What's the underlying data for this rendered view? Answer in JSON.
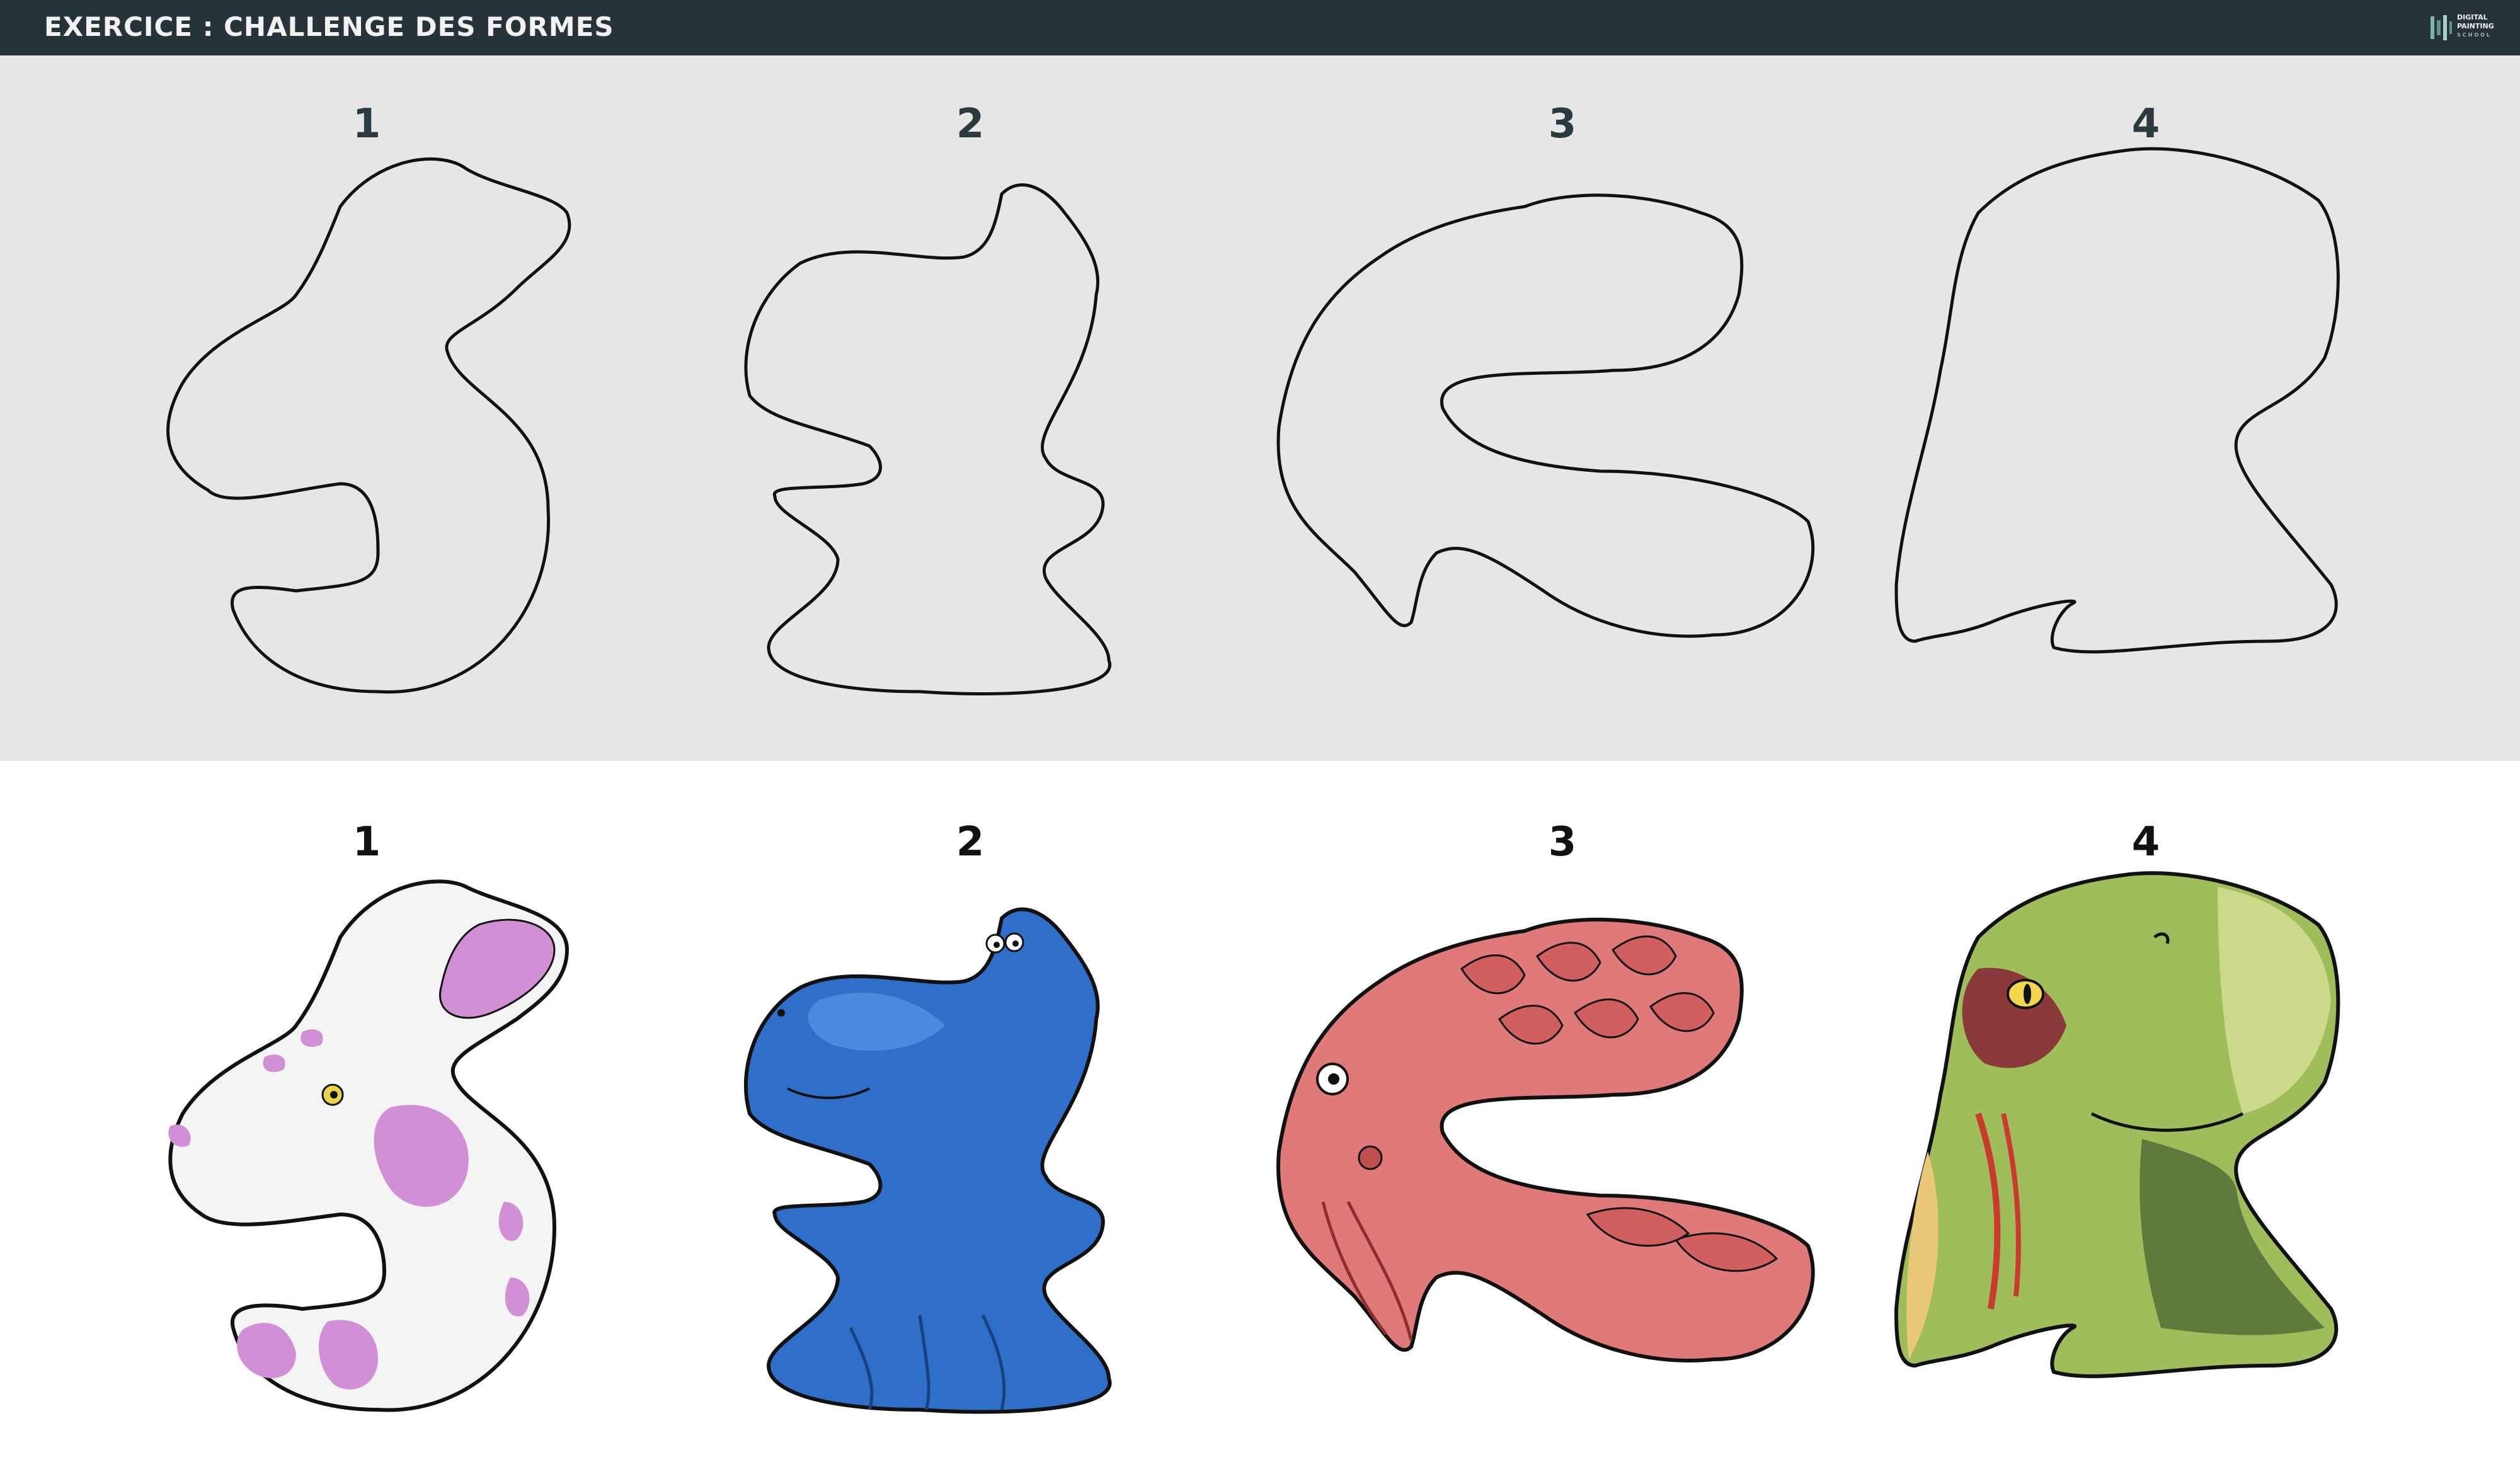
{
  "header": {
    "title": "EXERCICE : CHALLENGE DES FORMES",
    "logo_line1": "DIGITAL",
    "logo_line2": "PAINTING",
    "logo_line3": "SCHOOL"
  },
  "outlines": {
    "labels": [
      "1",
      "2",
      "3",
      "4"
    ]
  },
  "creatures": {
    "labels": [
      "1",
      "2",
      "3",
      "4"
    ]
  },
  "colors": {
    "header_bg": "#263338",
    "upper_bg": "#e6e6e6",
    "creature1": "#d18fd6",
    "creature2": "#2f6fc9",
    "creature3": "#e07a7a",
    "creature4": "#9fbd5a"
  }
}
